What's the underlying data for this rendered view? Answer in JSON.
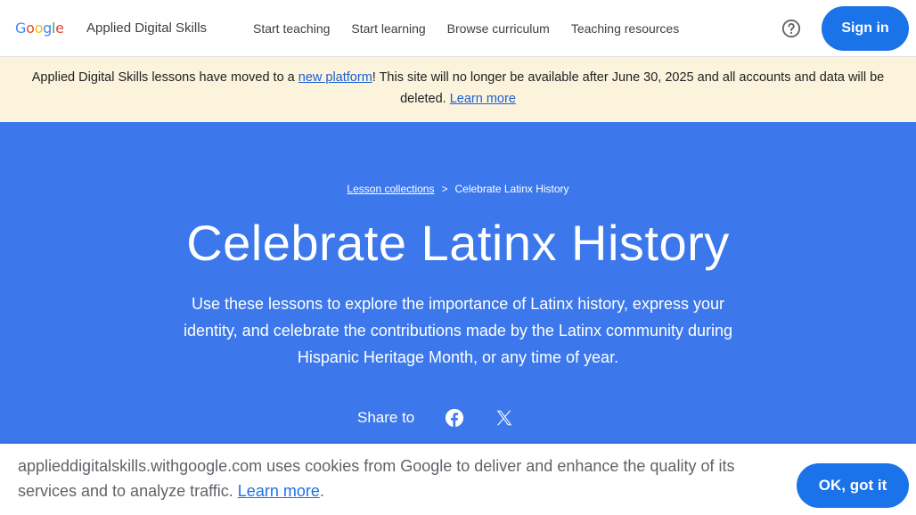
{
  "header": {
    "logo_parts": [
      "G",
      "o",
      "o",
      "g",
      "l",
      "e"
    ],
    "brand": "Applied Digital Skills",
    "nav": [
      "Start teaching",
      "Start learning",
      "Browse curriculum",
      "Teaching resources"
    ],
    "help_icon": "help-circle-icon",
    "signin_label": "Sign in"
  },
  "banner": {
    "text_before": "Applied Digital Skills lessons have moved to a ",
    "link1": "new platform",
    "text_after": "! This site will no longer be available after June 30, 2025 and all accounts and data will be deleted. ",
    "link2": "Learn more",
    "background": "#fbf3dc"
  },
  "hero": {
    "background": "#3c78ec",
    "breadcrumb": {
      "parent": "Lesson collections",
      "separator": ">",
      "current": "Celebrate Latinx History"
    },
    "title": "Celebrate Latinx History",
    "description": "Use these lessons to explore the importance of Latinx history, express your identity, and celebrate the contributions made by the Latinx community during Hispanic Heritage Month, or any time of year.",
    "share_label": "Share to",
    "share_icons": [
      "facebook-icon",
      "x-icon"
    ]
  },
  "cookie": {
    "text": "applieddigitalskills.withgoogle.com uses cookies from Google to deliver and enhance the quality of its services and to analyze traffic. ",
    "link": "Learn more",
    "period": ".",
    "ok_label": "OK, got it"
  }
}
